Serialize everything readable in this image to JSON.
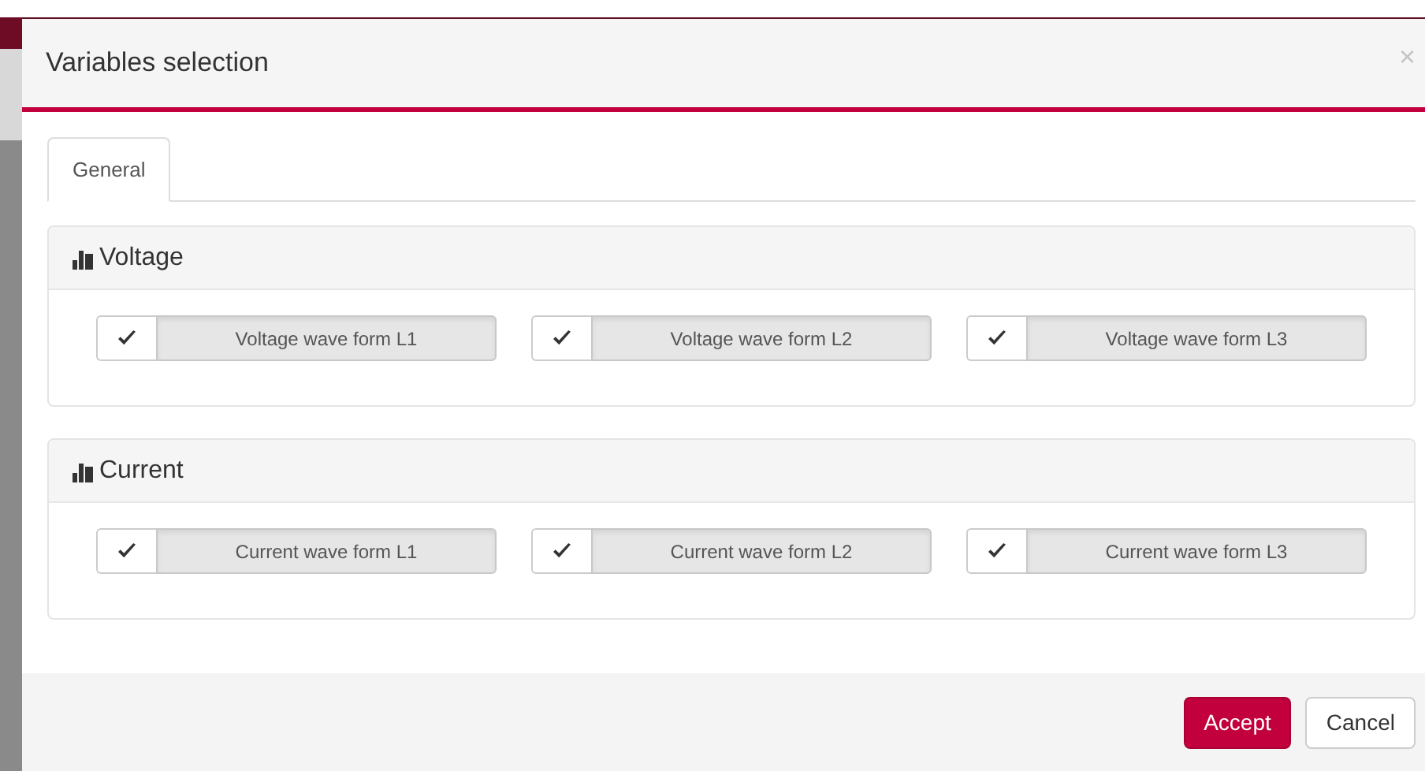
{
  "dialog": {
    "title": "Variables selection",
    "close": "×"
  },
  "tabs": [
    {
      "label": "General",
      "selected": true
    }
  ],
  "groups": [
    {
      "title": "Voltage",
      "options": [
        {
          "label": "Voltage wave form L1",
          "checked": true
        },
        {
          "label": "Voltage wave form L2",
          "checked": true
        },
        {
          "label": "Voltage wave form L3",
          "checked": true
        }
      ]
    },
    {
      "title": "Current",
      "options": [
        {
          "label": "Current wave form L1",
          "checked": true
        },
        {
          "label": "Current wave form L2",
          "checked": true
        },
        {
          "label": "Current wave form L3",
          "checked": true
        }
      ]
    }
  ],
  "buttons": [
    {
      "label": "Accept",
      "kind": "primary"
    },
    {
      "label": "Cancel",
      "kind": "default"
    }
  ]
}
